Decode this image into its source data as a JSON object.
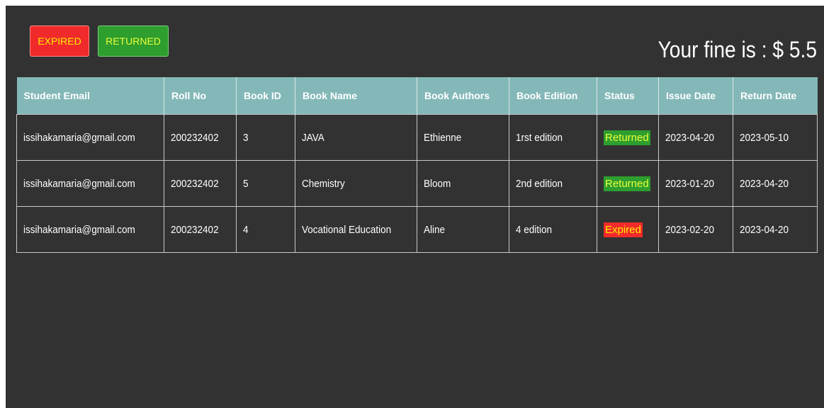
{
  "filters": {
    "expired_label": "EXPIRED",
    "returned_label": "RETURNED"
  },
  "fine_text": "Your fine is : $ 5.5",
  "table": {
    "headers": [
      "Student Email",
      "Roll No",
      "Book ID",
      "Book Name",
      "Book Authors",
      "Book Edition",
      "Status",
      "Issue Date",
      "Return Date"
    ],
    "rows": [
      {
        "email": "issihakamaria@gmail.com",
        "roll": "200232402",
        "book_id": "3",
        "book_name": "JAVA",
        "author": "Ethienne",
        "edition": "1rst edition",
        "status": "Returned",
        "issue_date": "2023-04-20",
        "return_date": "2023-05-10"
      },
      {
        "email": "issihakamaria@gmail.com",
        "roll": "200232402",
        "book_id": "5",
        "book_name": "Chemistry",
        "author": "Bloom",
        "edition": "2nd edition",
        "status": "Returned",
        "issue_date": "2023-01-20",
        "return_date": "2023-04-20"
      },
      {
        "email": "issihakamaria@gmail.com",
        "roll": "200232402",
        "book_id": "4",
        "book_name": "Vocational Education",
        "author": "Aline",
        "edition": "4 edition",
        "status": "Expired",
        "issue_date": "2023-02-20",
        "return_date": "2023-04-20"
      }
    ]
  },
  "colors": {
    "background": "#323232",
    "header": "#84b8b8",
    "returned": "#2e9e2e",
    "expired": "#f02a2a",
    "status_text": "#eaff3a"
  }
}
